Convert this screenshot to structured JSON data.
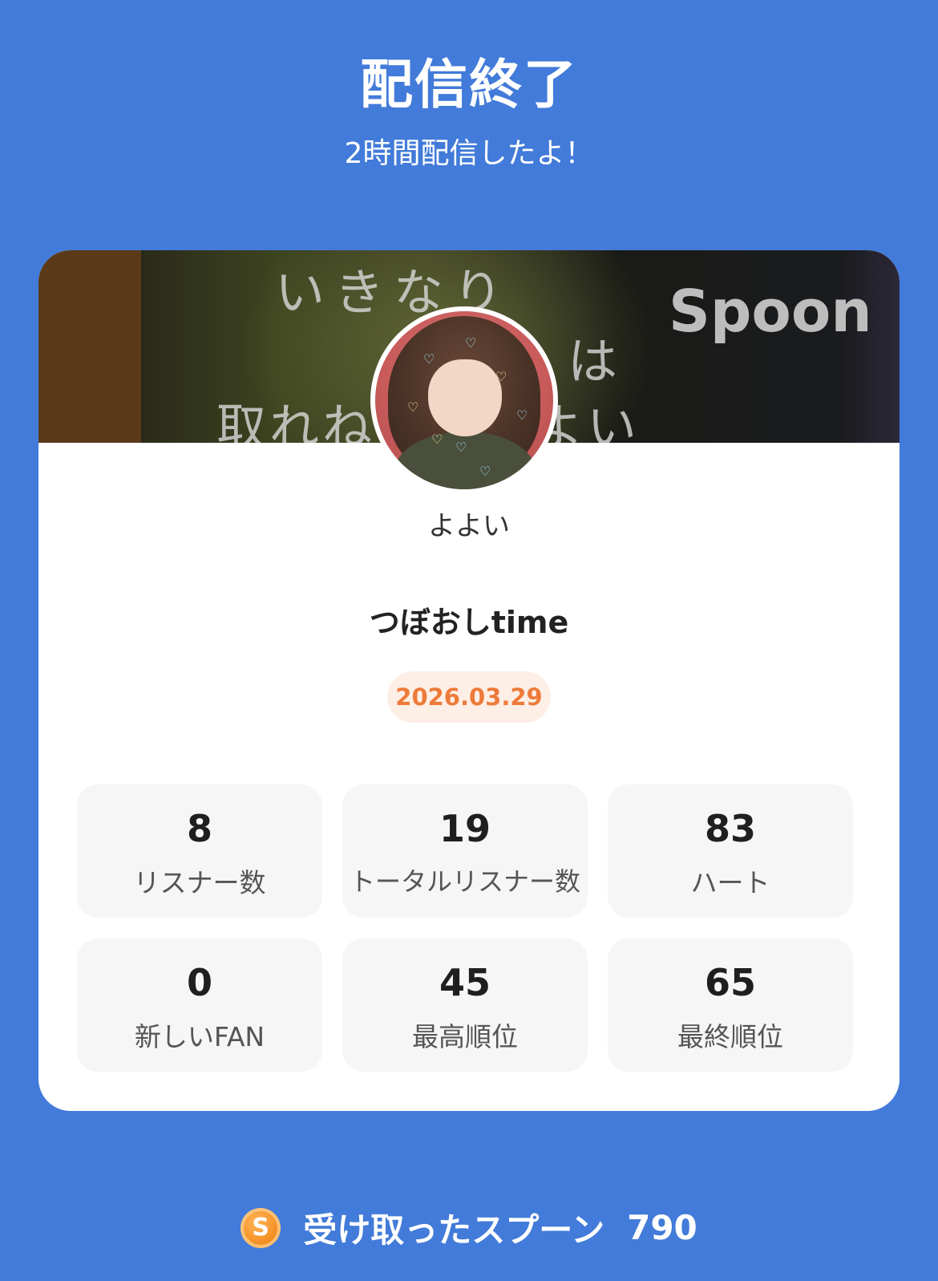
{
  "header": {
    "title": "配信終了",
    "subtitle": "2時間配信したよ！"
  },
  "banner": {
    "text_line1": "いきなり",
    "text_line2": "は",
    "text_line3": "取れね　　うよい",
    "logo": "Spoon"
  },
  "profile": {
    "username": "よよい",
    "avatar_icon": "user-avatar"
  },
  "broadcast": {
    "title": "つぼおしtime",
    "date": "2026.03.29"
  },
  "stats": [
    {
      "value": "8",
      "label": "リスナー数"
    },
    {
      "value": "19",
      "label": "トータルリスナー数"
    },
    {
      "value": "83",
      "label": "ハート"
    },
    {
      "value": "0",
      "label": "新しいFAN"
    },
    {
      "value": "45",
      "label": "最高順位"
    },
    {
      "value": "65",
      "label": "最終順位"
    }
  ],
  "spoons": {
    "icon_letter": "S",
    "label": "受け取ったスプーン",
    "value": "790"
  },
  "colors": {
    "background": "#427bd9",
    "date_accent": "#ee7a3a",
    "spoon_icon": "#f28a1c"
  }
}
